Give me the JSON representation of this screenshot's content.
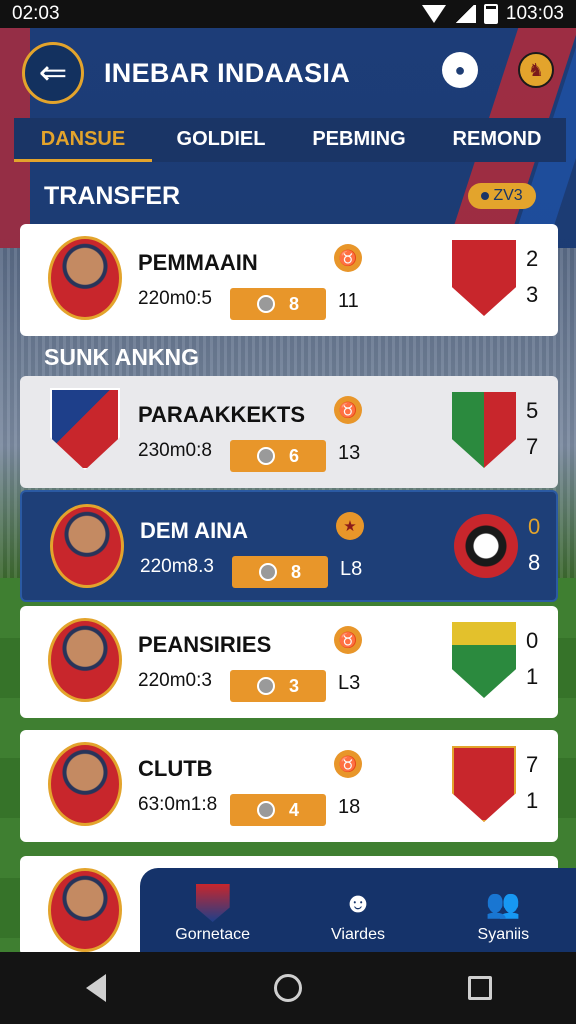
{
  "status_bar": {
    "time_left": "02:03",
    "time_right": "103:03"
  },
  "header": {
    "title": "INEBAR INDAASIA"
  },
  "tabs": [
    {
      "label": "DANSUE",
      "active": true
    },
    {
      "label": "GOLDIEL",
      "active": false
    },
    {
      "label": "PEBMING",
      "active": false
    },
    {
      "label": "REMOND",
      "active": false
    }
  ],
  "sections": {
    "transfer": {
      "title": "TRANSFER",
      "badge": "ZV3"
    },
    "ranking": {
      "title": "SUNK ANKNG"
    }
  },
  "cards": [
    {
      "name": "PEMMAAIN",
      "stat": "220m0:5",
      "pill_value": "8",
      "count": "11",
      "score_top": "2",
      "score_bottom": "3"
    },
    {
      "name": "PARAAKKEKTS",
      "stat": "230m0:8",
      "pill_value": "6",
      "count": "13",
      "score_top": "5",
      "score_bottom": "7"
    },
    {
      "name": "DEM AINA",
      "stat": "220m8.3",
      "pill_value": "8",
      "count": "L8",
      "score_top": "0",
      "score_bottom": "8"
    },
    {
      "name": "PEANSIRIES",
      "stat": "220m0:3",
      "pill_value": "3",
      "count": "L3",
      "score_top": "0",
      "score_bottom": "1"
    },
    {
      "name": "CLUTB",
      "stat": "63:0m1:8",
      "pill_value": "4",
      "count": "18",
      "score_top": "7",
      "score_bottom": "1"
    }
  ],
  "bottom_nav": [
    {
      "label": "Gornetace",
      "icon": "shield-icon"
    },
    {
      "label": "Viardes",
      "icon": "mascot-icon"
    },
    {
      "label": "Syaniis",
      "icon": "users-icon"
    }
  ],
  "colors": {
    "accent": "#e3a42c",
    "primary": "#1a3566",
    "pill": "#e8962a"
  }
}
